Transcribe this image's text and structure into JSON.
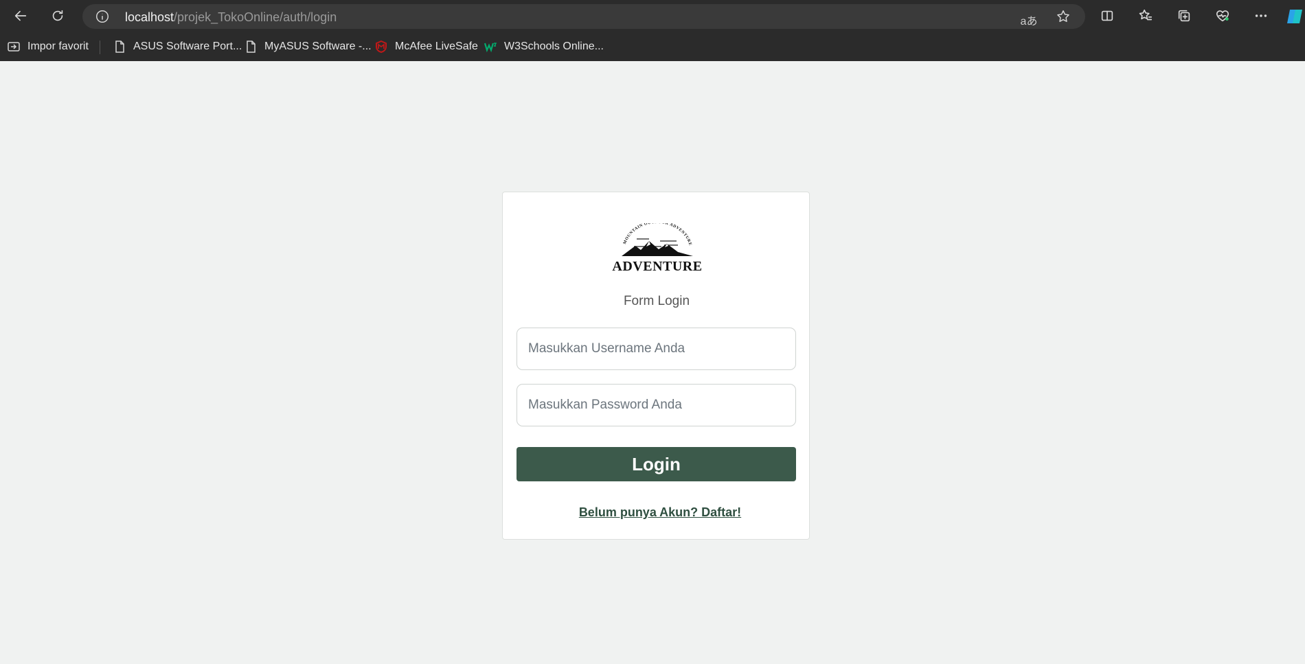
{
  "browser": {
    "url_host": "localhost",
    "url_path": "/projek_TokoOnline/auth/login",
    "read_aloud_glyph": "aあ",
    "bookmarks": [
      {
        "label": "Impor favorit",
        "icon": "import-favorites-icon"
      },
      {
        "label": "ASUS Software Port...",
        "icon": "page-icon"
      },
      {
        "label": "MyASUS Software -...",
        "icon": "page-icon"
      },
      {
        "label": "McAfee LiveSafe",
        "icon": "mcafee-icon"
      },
      {
        "label": "W3Schools Online...",
        "icon": "w3schools-icon"
      }
    ],
    "colors": {
      "chrome": "#2b2b2b",
      "address_bar": "#3a3a3a"
    }
  },
  "login": {
    "logo_text": "ADVENTURE",
    "logo_arc_text": "MOUNTAIN OUTDOOR ADVENTURE",
    "title": "Form Login",
    "username_placeholder": "Masukkan Username Anda",
    "password_placeholder": "Masukkan Password Anda",
    "login_label": "Login",
    "register_link": "Belum punya Akun? Daftar!",
    "colors": {
      "button": "#3c5a4b",
      "link": "#2f4f40",
      "background": "#f0f2f1"
    }
  }
}
